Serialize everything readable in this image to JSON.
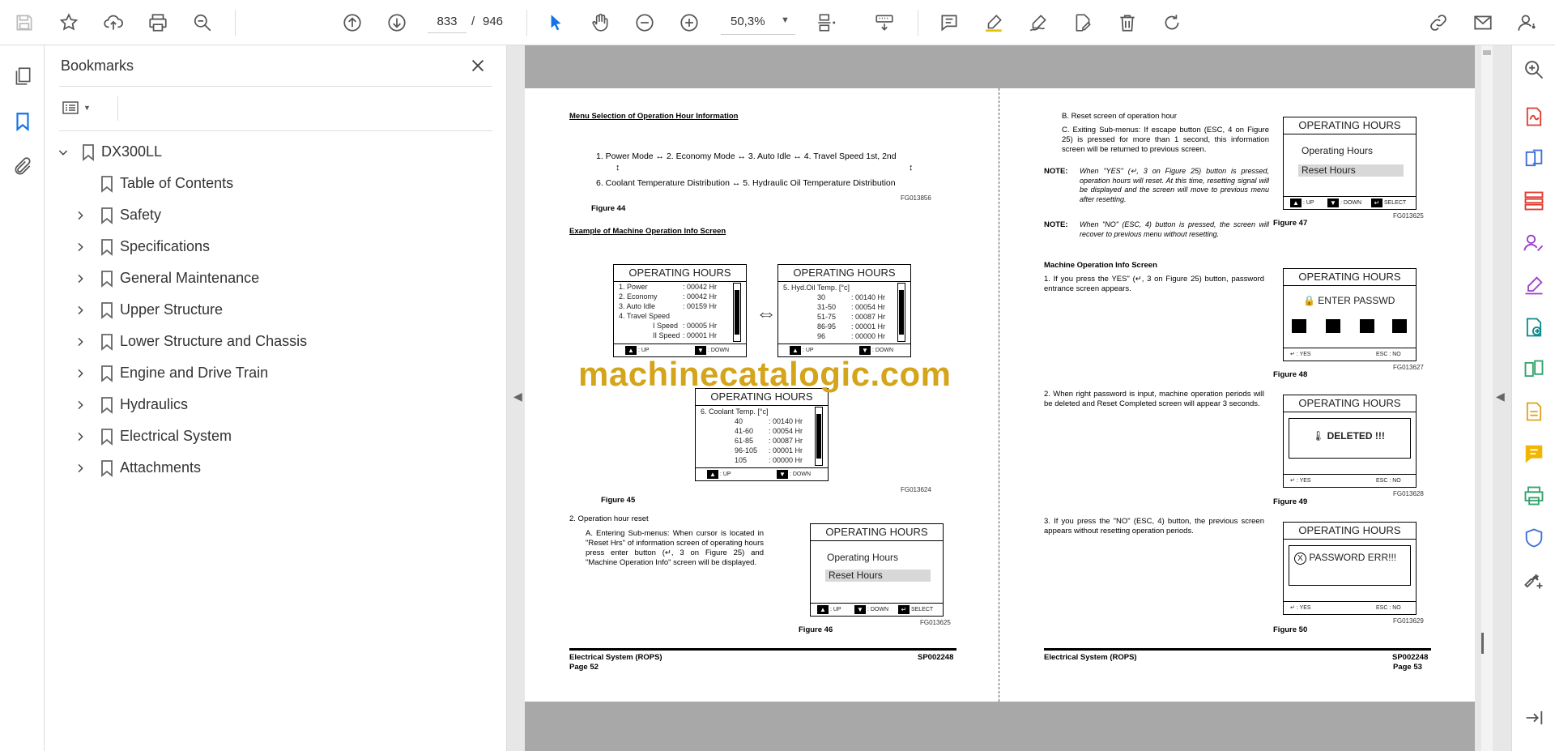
{
  "toolbar": {
    "current_page": "833",
    "page_separator": "/",
    "total_pages": "946",
    "zoom": "50,3%",
    "icons": [
      "save-icon",
      "bookmark-star-icon",
      "upload-icon",
      "print-icon",
      "zoom-search-icon",
      "page-up-icon",
      "page-down-icon",
      "select-cursor-icon",
      "hand-icon",
      "zoom-out-icon",
      "zoom-in-icon",
      "page-fit-icon",
      "scroll-mode-icon",
      "comment-icon",
      "highlight-icon",
      "sign-icon",
      "edit-pdf-icon",
      "delete-icon",
      "rotate-icon",
      "share-link-icon",
      "email-icon",
      "account-icon"
    ]
  },
  "bookmarks": {
    "title": "Bookmarks",
    "root": "DX300LL",
    "items": [
      {
        "label": "Table of Contents",
        "expandable": false
      },
      {
        "label": "Safety",
        "expandable": true
      },
      {
        "label": "Specifications",
        "expandable": true
      },
      {
        "label": "General Maintenance",
        "expandable": true
      },
      {
        "label": "Upper Structure",
        "expandable": true
      },
      {
        "label": "Lower Structure and Chassis",
        "expandable": true
      },
      {
        "label": "Engine and Drive Train",
        "expandable": true
      },
      {
        "label": "Hydraulics",
        "expandable": true
      },
      {
        "label": "Electrical System",
        "expandable": true
      },
      {
        "label": "Attachments",
        "expandable": true
      }
    ]
  },
  "document": {
    "watermark": "machinecatalogic.com",
    "left": {
      "heading1": "Menu Selection of Operation Hour Information",
      "menu_row1": "1. Power Mode ↔  2. Economy Mode ↔  3. Auto Idle ↔  4. Travel Speed 1st, 2nd",
      "menu_row2": "6. Coolant Temperature Distribution ↔  5. Hydraulic Oil Temperature Distribution",
      "fig44_code": "FG013856",
      "fig44": "Figure 44",
      "heading2": "Example of Machine Operation Info Screen",
      "lcd_title": "OPERATING HOURS",
      "lcd1_rows": [
        {
          "k": "1. Power",
          "v": ": 00042 Hr"
        },
        {
          "k": "2. Economy",
          "v": ": 00042 Hr"
        },
        {
          "k": "3. Auto Idle",
          "v": ": 00159 Hr"
        },
        {
          "k": "4. Travel Speed",
          "v": ""
        },
        {
          "k": "I Speed",
          "v": ": 00005 Hr"
        },
        {
          "k": "II Speed",
          "v": ": 00001 Hr"
        }
      ],
      "lcd2_head": "5. Hyd.Oil Temp. [°c]",
      "lcd2_rows": [
        {
          "k": "30",
          "v": ": 00140 Hr"
        },
        {
          "k": "31-50",
          "v": ": 00054 Hr"
        },
        {
          "k": "51-75",
          "v": ": 00087 Hr"
        },
        {
          "k": "86-95",
          "v": ": 00001 Hr"
        },
        {
          "k": "96",
          "v": ": 00000 Hr"
        }
      ],
      "lcd3_head": "6. Coolant Temp. [°c]",
      "lcd3_rows": [
        {
          "k": "40",
          "v": ": 00140 Hr"
        },
        {
          "k": "41-60",
          "v": ": 00054 Hr"
        },
        {
          "k": "61-85",
          "v": ": 00087 Hr"
        },
        {
          "k": "96-105",
          "v": ": 00001 Hr"
        },
        {
          "k": "105",
          "v": ": 00000 Hr"
        }
      ],
      "up": ": UP",
      "down": ": DOWN",
      "select": "SELECT",
      "fig45_code": "FG013624",
      "fig45": "Figure 45",
      "step2": "2.    Operation hour reset",
      "stepA": "A.    Entering Sub-menus: When cursor is located in \"Reset Hrs\" of information screen of operating hours press enter button (↵, 3 on Figure 25) and \"Machine Operation Info\" screen will be displayed.",
      "menu_item1": "Operating Hours",
      "menu_item2": "Reset Hours",
      "fig46_code": "FG013625",
      "fig46": "Figure 46",
      "footer_left": "Electrical System (ROPS)",
      "footer_page": "Page 52",
      "footer_code": "SP002248"
    },
    "right": {
      "B": "B.    Reset screen of operation hour",
      "C": "C.    Exiting Sub-menus: If escape button (ESC, 4 on Figure 25) is pressed for more than 1 second, this information screen will be returned to previous screen.",
      "note1_label": "NOTE:",
      "note1": "When \"YES\" (↵, 3 on Figure 25) button is pressed, operation hours will reset. At this time, resetting signal will be displayed and the screen will move to previous menu after resetting.",
      "note2_label": "NOTE:",
      "note2": "When \"NO\" (ESC, 4) button is pressed, the screen will recover to previous menu without resetting.",
      "fig47_code": "FG013625",
      "fig47": "Figure 47",
      "heading": "Machine Operation Info Screen",
      "p1": "1.    If you press the YES\" (↵, 3 on Figure 25) button, password entrance screen appears.",
      "p2": "2.    When right password is input, machine operation periods will be deleted and Reset Completed screen will appear 3 seconds.",
      "p3": "3.    If you press the \"NO\" (ESC, 4) button, the previous screen appears without resetting operation periods.",
      "enter_passwd": "ENTER PASSWD",
      "deleted": "DELETED !!!",
      "password_err": "PASSWORD ERR!!!",
      "yes": ": YES",
      "esc_no": "ESC : NO",
      "fig48_code": "FG013627",
      "fig48": "Figure 48",
      "fig49_code": "FG013628",
      "fig49": "Figure 49",
      "fig50_code": "FG013629",
      "fig50": "Figure 50",
      "footer_left": "Electrical System (ROPS)",
      "footer_page": "Page 53",
      "footer_code": "SP002248"
    }
  }
}
